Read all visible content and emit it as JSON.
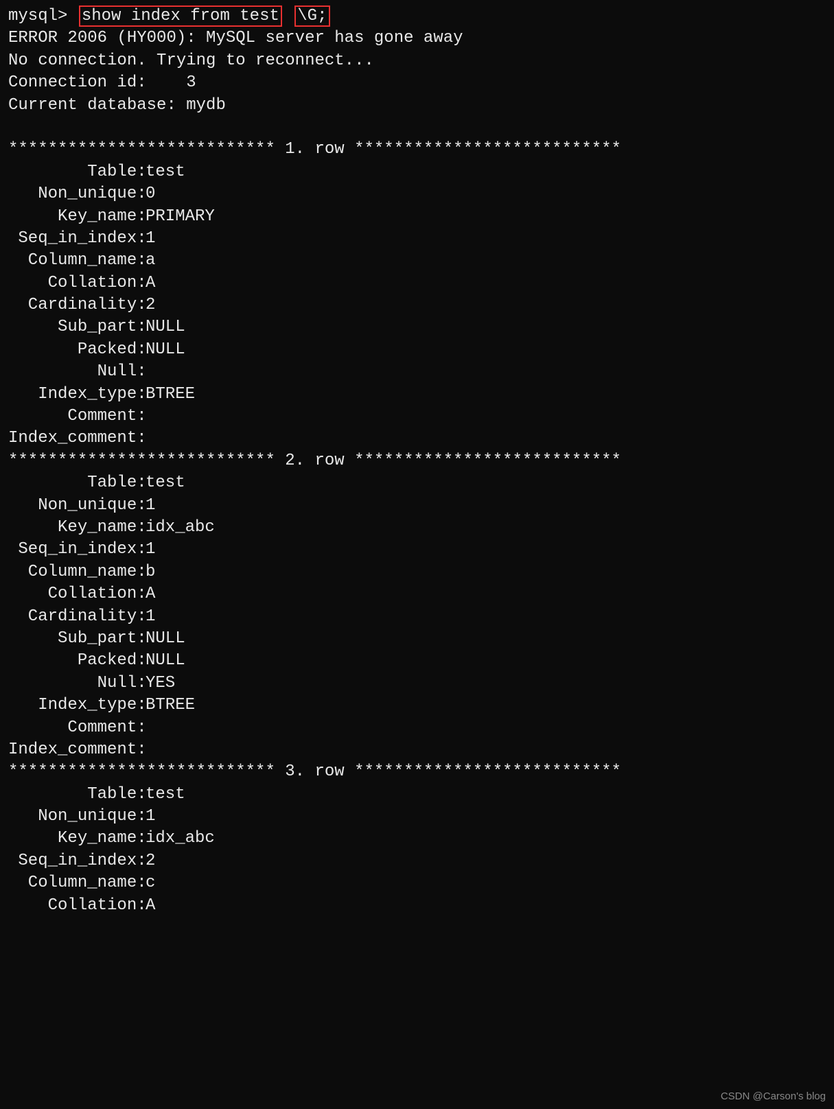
{
  "prompt": "mysql>",
  "command_part1": "show index from test",
  "command_part2": "\\G;",
  "error_line": "ERROR 2006 (HY000): MySQL server has gone away",
  "reconnect_line": "No connection. Trying to reconnect...",
  "conn_id_label": "Connection id:    ",
  "conn_id_value": "3",
  "db_label": "Current database: ",
  "db_value": "mydb",
  "row_sep_prefix": "*************************** ",
  "row_sep_suffix": ". row ***************************",
  "rows": [
    {
      "num": "1",
      "fields": [
        {
          "label": "        Table: ",
          "value": "test"
        },
        {
          "label": "   Non_unique: ",
          "value": "0"
        },
        {
          "label": "     Key_name: ",
          "value": "PRIMARY"
        },
        {
          "label": " Seq_in_index: ",
          "value": "1"
        },
        {
          "label": "  Column_name: ",
          "value": "a"
        },
        {
          "label": "    Collation: ",
          "value": "A"
        },
        {
          "label": "  Cardinality: ",
          "value": "2"
        },
        {
          "label": "     Sub_part: ",
          "value": "NULL"
        },
        {
          "label": "       Packed: ",
          "value": "NULL"
        },
        {
          "label": "         Null: ",
          "value": ""
        },
        {
          "label": "   Index_type: ",
          "value": "BTREE"
        },
        {
          "label": "      Comment: ",
          "value": ""
        },
        {
          "label": "Index_comment: ",
          "value": ""
        }
      ]
    },
    {
      "num": "2",
      "fields": [
        {
          "label": "        Table: ",
          "value": "test"
        },
        {
          "label": "   Non_unique: ",
          "value": "1"
        },
        {
          "label": "     Key_name: ",
          "value": "idx_abc"
        },
        {
          "label": " Seq_in_index: ",
          "value": "1"
        },
        {
          "label": "  Column_name: ",
          "value": "b"
        },
        {
          "label": "    Collation: ",
          "value": "A"
        },
        {
          "label": "  Cardinality: ",
          "value": "1"
        },
        {
          "label": "     Sub_part: ",
          "value": "NULL"
        },
        {
          "label": "       Packed: ",
          "value": "NULL"
        },
        {
          "label": "         Null: ",
          "value": "YES"
        },
        {
          "label": "   Index_type: ",
          "value": "BTREE"
        },
        {
          "label": "      Comment: ",
          "value": ""
        },
        {
          "label": "Index_comment: ",
          "value": ""
        }
      ]
    },
    {
      "num": "3",
      "fields": [
        {
          "label": "        Table: ",
          "value": "test"
        },
        {
          "label": "   Non_unique: ",
          "value": "1"
        },
        {
          "label": "     Key_name: ",
          "value": "idx_abc"
        },
        {
          "label": " Seq_in_index: ",
          "value": "2"
        },
        {
          "label": "  Column_name: ",
          "value": "c"
        },
        {
          "label": "    Collation: ",
          "value": "A"
        }
      ]
    }
  ],
  "watermark": "CSDN @Carson's  blog"
}
